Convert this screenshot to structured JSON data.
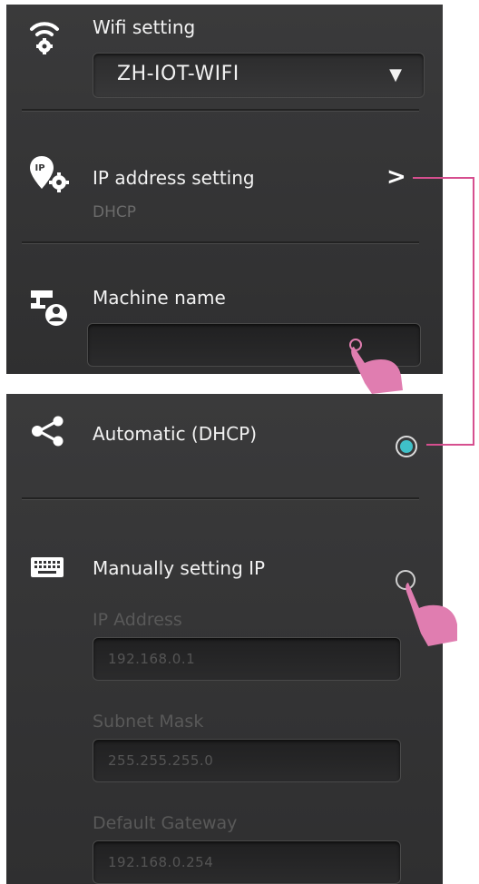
{
  "wifi": {
    "title": "Wifi setting",
    "selected_network": "ZH-IOT-WIFI",
    "dropdown_arrow": "▼"
  },
  "ip_setting": {
    "title": "IP address setting",
    "mode": "DHCP",
    "chevron": ">"
  },
  "machine": {
    "title": "Machine name",
    "value": ""
  },
  "options": {
    "automatic_label": "Automatic (DHCP)",
    "automatic_selected": true,
    "manual_label": "Manually setting IP",
    "manual_selected": false
  },
  "manual_fields": {
    "ip_label": "IP Address",
    "ip_value": "192.168.0.1",
    "subnet_label": "Subnet Mask",
    "subnet_value": "255.255.255.0",
    "gateway_label": "Default Gateway",
    "gateway_value": "192.168.0.254"
  },
  "colors": {
    "accent_teal": "#3fc1c9",
    "connector_pink": "#d64f8f",
    "hand_pink": "#e07db0"
  },
  "icons": [
    "wifi-gear-icon",
    "ip-gear-icon",
    "machine-user-icon",
    "share-icon",
    "keyboard-icon",
    "pointer-hand-icon"
  ]
}
